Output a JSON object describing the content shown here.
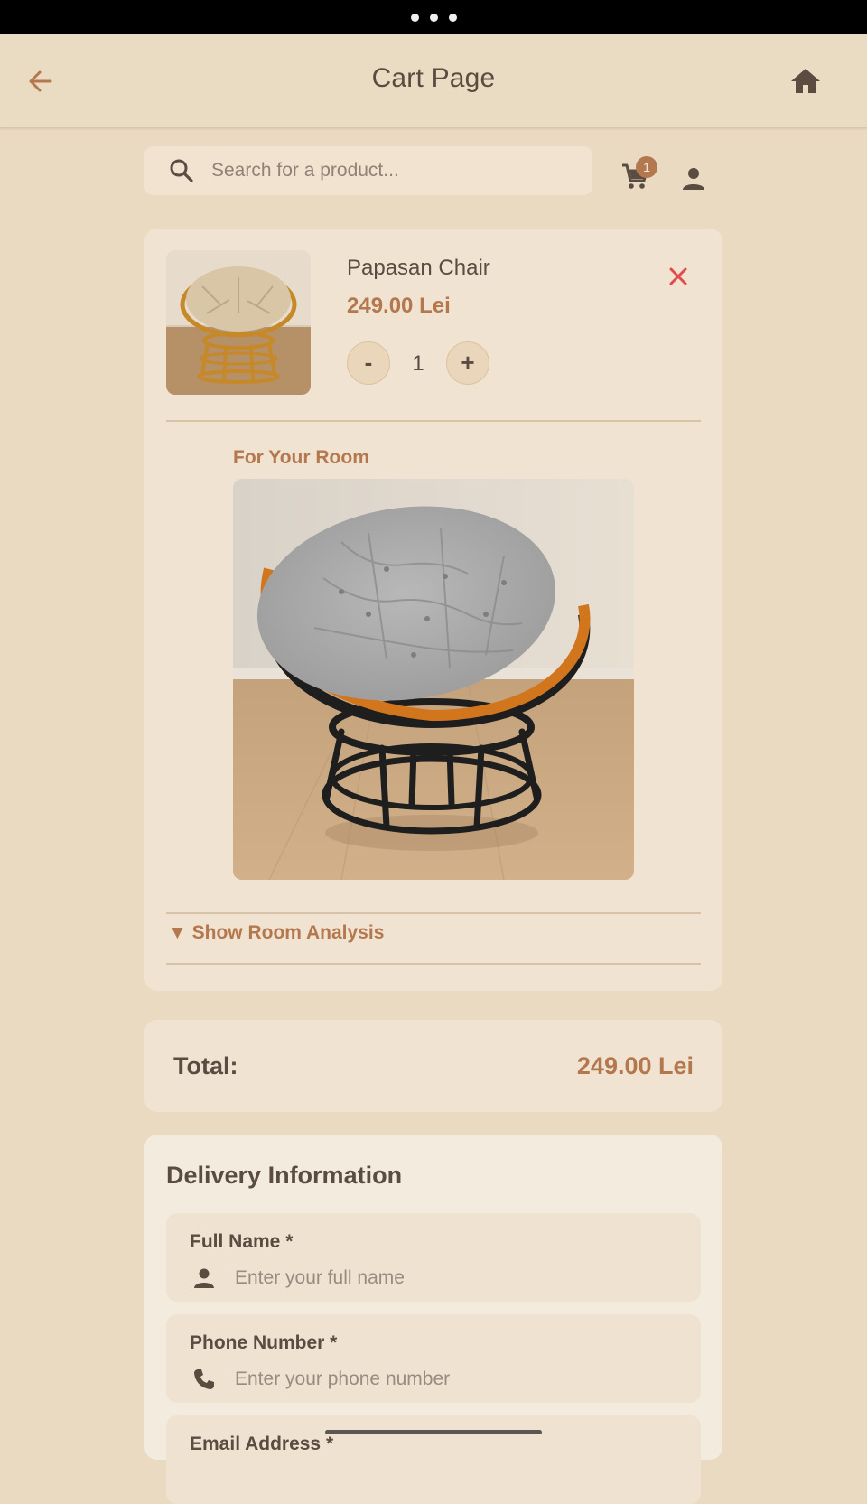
{
  "app_bar": {
    "title": "Cart Page",
    "back_icon": "arrow-left-icon",
    "home_icon": "home-icon"
  },
  "search": {
    "placeholder": "Search for a product...",
    "value": "",
    "icon": "search-icon"
  },
  "header_actions": {
    "cart_icon": "shopping-cart-icon",
    "cart_count": "1",
    "profile_icon": "person-icon"
  },
  "cart": {
    "items": [
      {
        "name": "Papasan Chair",
        "price": "249.00 Lei",
        "quantity": "1",
        "minus_label": "-",
        "plus_label": "+",
        "remove_icon": "close-icon"
      }
    ],
    "room_section_label": "For Your Room",
    "room_analysis_toggle": "▼ Show Room Analysis"
  },
  "summary": {
    "total_label": "Total:",
    "total_value": "249.00 Lei"
  },
  "delivery": {
    "title": "Delivery Information",
    "fields": [
      {
        "label": "Full Name *",
        "placeholder": "Enter your full name",
        "icon": "person-icon"
      },
      {
        "label": "Phone Number *",
        "placeholder": "Enter your phone number",
        "icon": "phone-icon"
      },
      {
        "label": "Email Address *",
        "placeholder": "",
        "icon": "email-icon"
      }
    ]
  },
  "colors": {
    "background": "#E9DAC1",
    "card": "#F1E3D1",
    "accent": "#B4784E",
    "text": "#5B4C42",
    "danger": "#E14B4B"
  }
}
